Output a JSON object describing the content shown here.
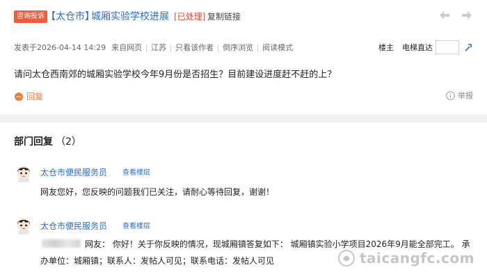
{
  "thread": {
    "badge": "咨询投诉",
    "city_tag": "【太仓市】",
    "title": "城厢实验学校进展",
    "status": "[已处理]",
    "copy_link": "复制链接"
  },
  "meta": {
    "posted": "发表于2026-04-14 14:29",
    "source": "来自网页",
    "region": "江苏",
    "only_author": "只看该作者",
    "reverse": "倒序浏览",
    "reading_mode": "阅读模式"
  },
  "floor": {
    "owner": "楼主",
    "jump_label": "电梯直达",
    "jump_value": ""
  },
  "post": {
    "question": "请问太仓西南郊的城厢实验学校今年9月份是否招生？目前建设进度赶不赶的上？",
    "reply_label": "回复",
    "report_label": "举报"
  },
  "department": {
    "heading": "部门回复",
    "count": "（2）"
  },
  "replies": [
    {
      "name": "太仓市便民服务员",
      "view_floor": "查看楼层",
      "text": "网友您好，您反映的问题我们已关注，请耐心等待回复，谢谢！"
    },
    {
      "name": "太仓市便民服务员",
      "view_floor": "查看楼层",
      "line1": "网友：  你好！关于你反映的情况，现城厢镇答复如下：  城厢镇实验小学项目2026年9月能全部完工。  承",
      "line2": "办单位：城厢镇；联系人：发帖人可见；联系电话：发帖人可见"
    }
  ],
  "watermark": "taicangfc.com",
  "colors": {
    "accent_blue": "#2c6ec5",
    "badge_orange": "#ee5e3c",
    "status_red": "#e8432c",
    "reply_orange": "#ef7d38"
  }
}
